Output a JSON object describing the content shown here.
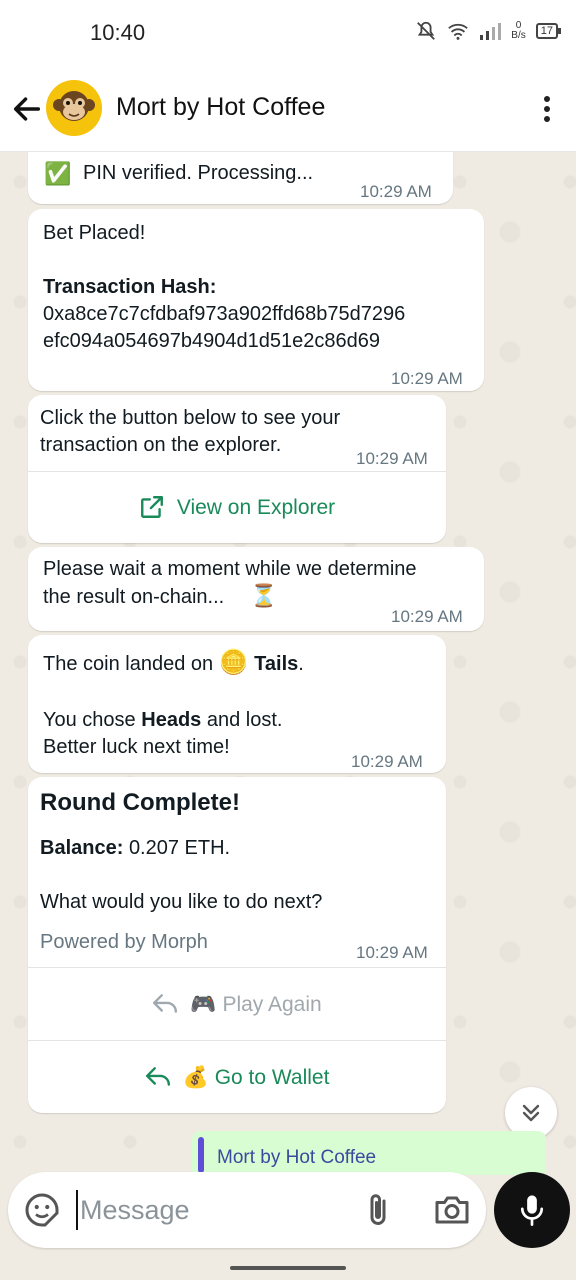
{
  "status_bar": {
    "time": "10:40",
    "net_speed_value": "0",
    "net_speed_unit": "B/s",
    "battery": "17"
  },
  "header": {
    "title": "Mort by Hot Coffee",
    "avatar": "monkey-face",
    "brand_color": "#f5c20c"
  },
  "messages": {
    "pin": {
      "check_icon": "✅",
      "text": "PIN verified. Processing...",
      "time": "10:29 AM"
    },
    "bet": {
      "line1": "Bet Placed!",
      "hash_label": "Transaction Hash:",
      "hash_line1": "0xa8ce7c7cfdbaf973a902ffd68b75d7296",
      "hash_line2": "efc094a054697b4904d1d51e2c86d69",
      "time": "10:29 AM"
    },
    "explorer": {
      "line1": "Click the button below to see your",
      "line2": "transaction on the explorer.",
      "time": "10:29 AM",
      "button_label": "View on Explorer"
    },
    "wait": {
      "line1": "Please wait a moment while we determine",
      "line2": "the result on-chain...",
      "hourglass": "⏳",
      "time": "10:29 AM"
    },
    "result": {
      "prefix": "The coin landed on",
      "coin": "🪙",
      "outcome": "Tails",
      "period": ".",
      "chose_prefix": "You chose",
      "choice": "Heads",
      "chose_suffix": "and lost.",
      "line3": "Better luck next time!",
      "time": "10:29 AM"
    },
    "round": {
      "title": "Round Complete!",
      "balance_label": "Balance:",
      "balance_value": "0.207 ETH.",
      "question": "What would you like to do next?",
      "footer": "Powered by Morph",
      "time": "10:29 AM",
      "play_again_emoji": "🎮",
      "play_again_label": "Play Again",
      "wallet_emoji": "💰",
      "wallet_label": "Go to Wallet"
    }
  },
  "quote_preview": {
    "name": "Mort by Hot Coffee"
  },
  "composer": {
    "placeholder": "Message"
  },
  "colors": {
    "accent_green": "#1a8a5a",
    "chat_bg": "#efeae2"
  }
}
